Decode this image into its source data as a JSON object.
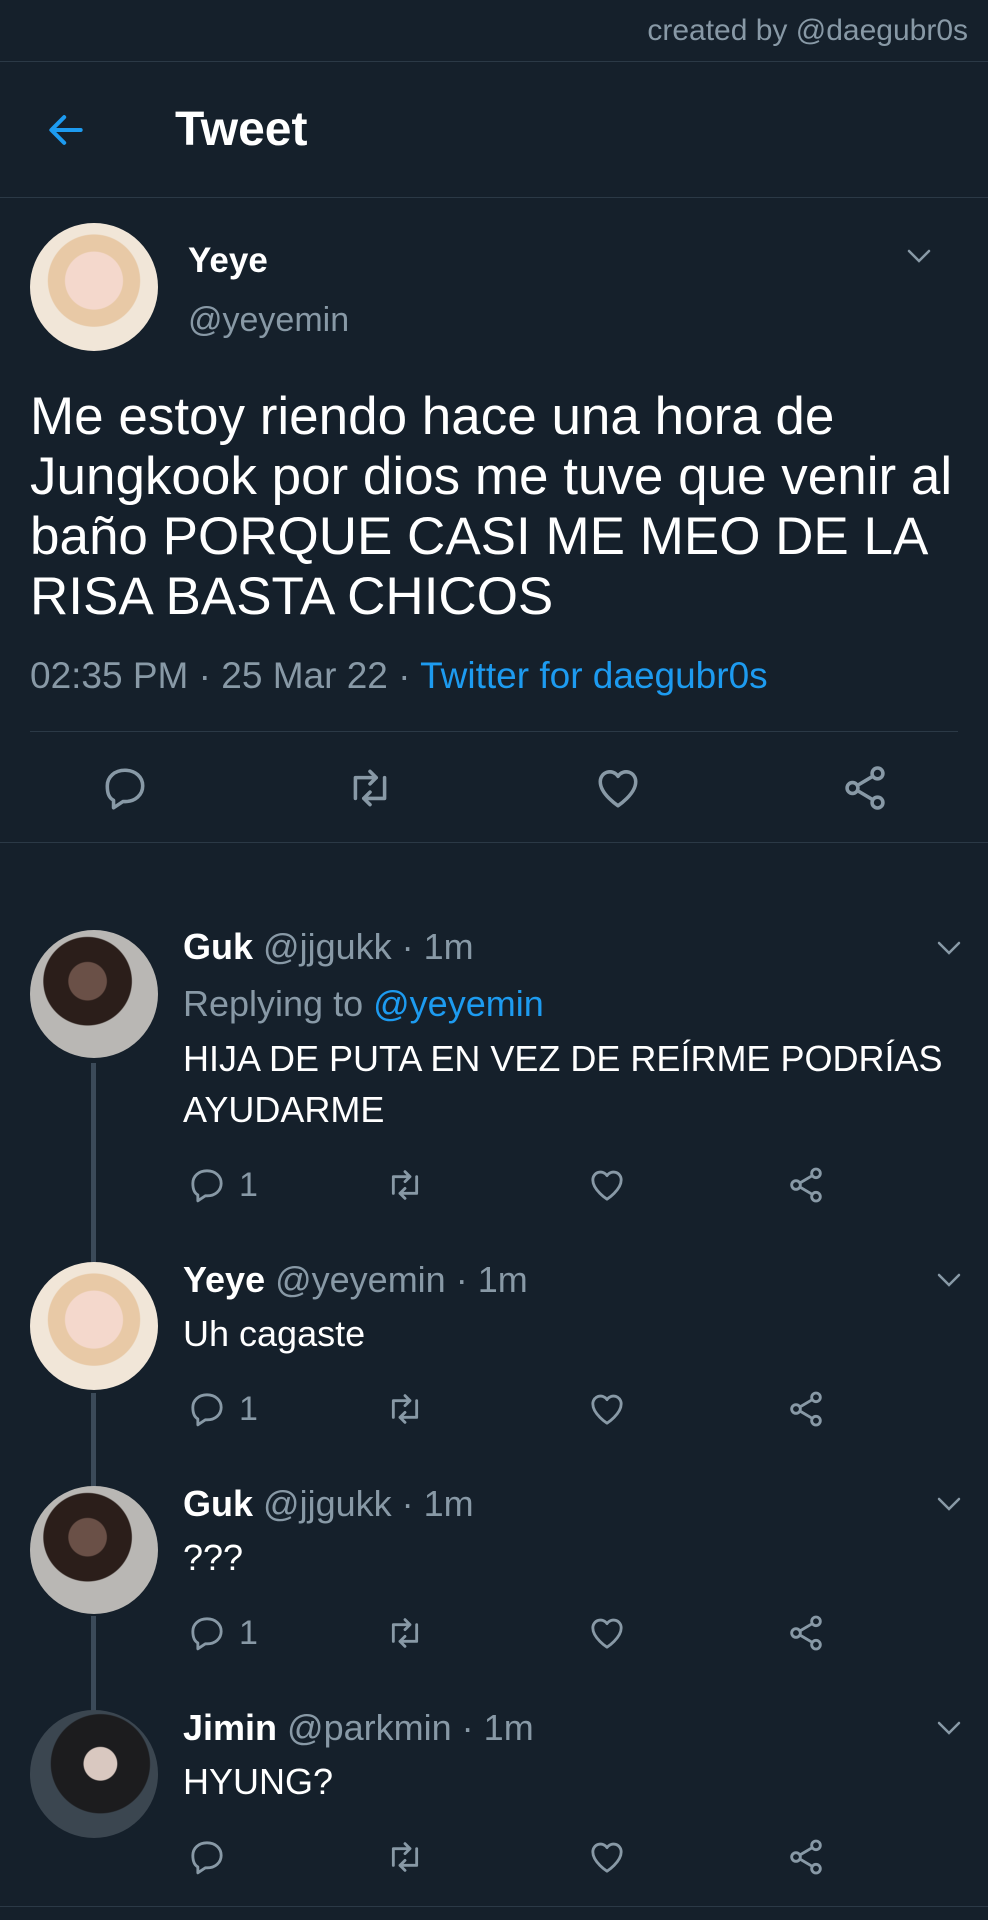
{
  "credit": "created by @daegubr0s",
  "header": {
    "title": "Tweet"
  },
  "main_tweet": {
    "name": "Yeye",
    "handle": "@yeyemin",
    "text": "Me estoy riendo hace una hora de Jungkook por dios me tuve que venir al baño PORQUE CASI ME MEO DE LA RISA  BASTA CHICOS",
    "time": "02:35 PM",
    "date": "25 Mar 22",
    "source": "Twitter for daegubr0s",
    "dot": "·"
  },
  "replies": [
    {
      "name": "Guk",
      "handle": "@jjgukk",
      "time": "1m",
      "replying_label": "Replying to",
      "replying_to": "@yeyemin",
      "text": "HIJA DE PUTA EN VEZ DE REÍRME PODRÍAS AYUDARME",
      "reply_count": "1"
    },
    {
      "name": "Yeye",
      "handle": "@yeyemin",
      "time": "1m",
      "text": "Uh cagaste",
      "reply_count": "1"
    },
    {
      "name": "Guk",
      "handle": "@jjgukk",
      "time": "1m",
      "text": "???",
      "reply_count": "1"
    },
    {
      "name": "Jimin",
      "handle": "@parkmin",
      "time": "1m",
      "text": "HYUNG?",
      "reply_count": ""
    }
  ],
  "colors": {
    "background": "#15202b",
    "accent": "#1d9bf0",
    "secondary_text": "#8899a6",
    "divider": "#2b3946"
  }
}
